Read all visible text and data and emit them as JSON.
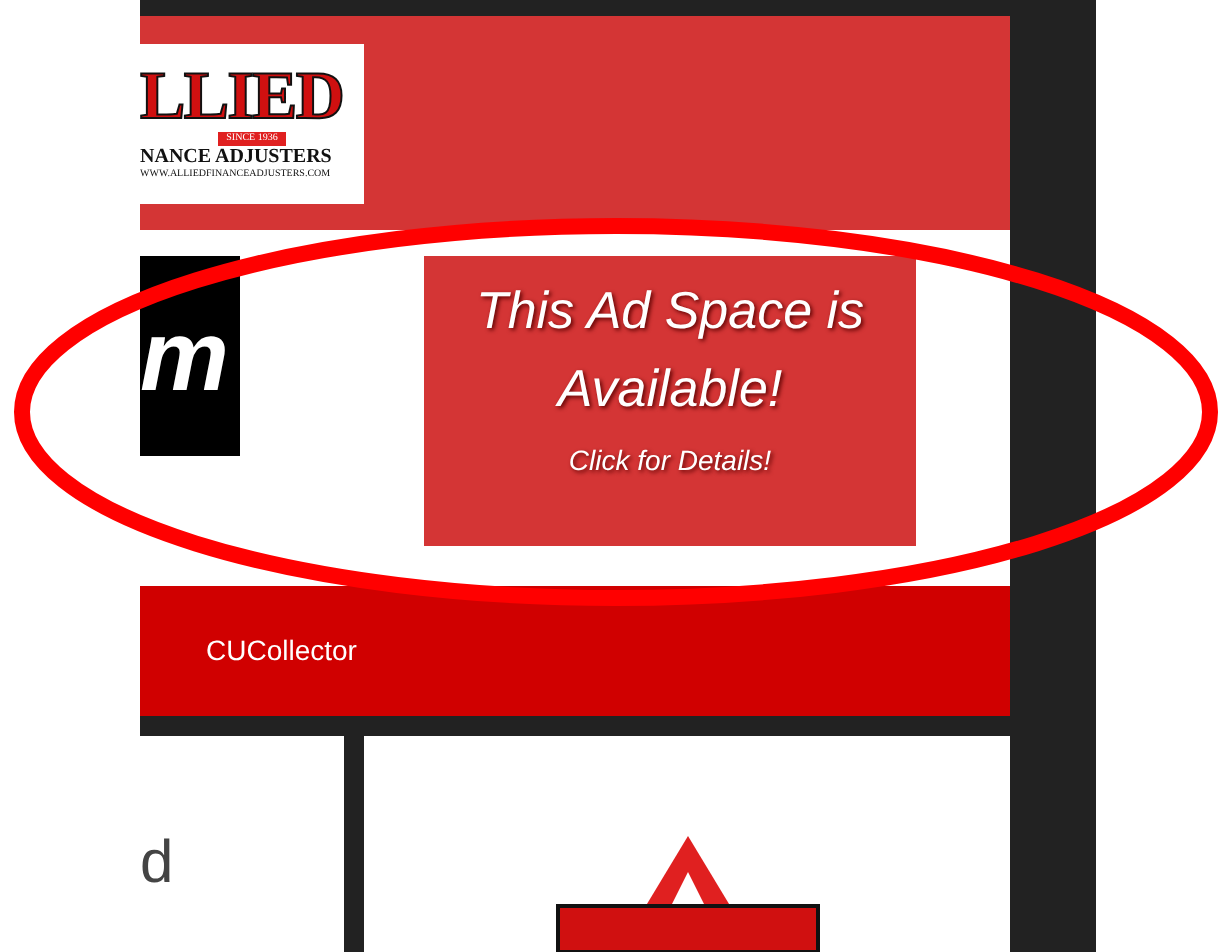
{
  "header": {
    "logo": {
      "title": "LLIED",
      "since": "SINCE 1936",
      "subtitle": "NANCE ADJUSTERS",
      "url": "WWW.ALLIEDFINANCEADJUSTERS.COM"
    }
  },
  "ad_row": {
    "left_banner_text": "m",
    "ad": {
      "headline_1": "This Ad Space is",
      "headline_2": "Available!",
      "cta": "Click for Details!"
    }
  },
  "footer_bar": {
    "label": "CUCollector"
  },
  "content": {
    "text_fragment": "d"
  }
}
